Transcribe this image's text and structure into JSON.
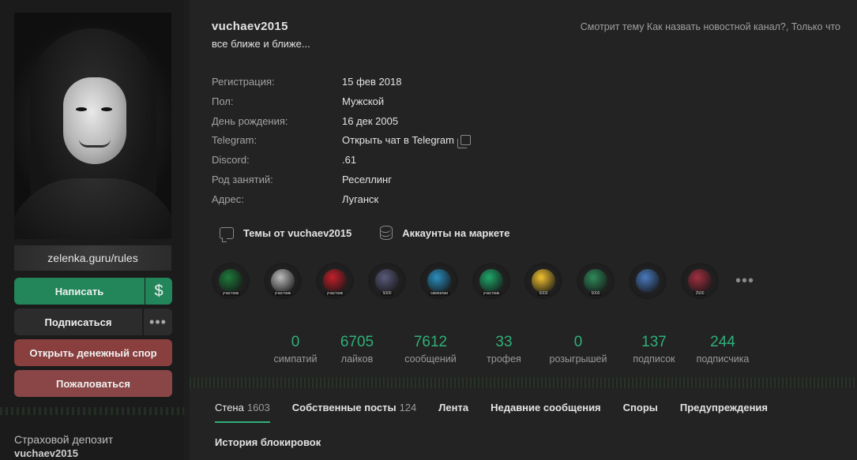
{
  "sidebar": {
    "status_banner": "zelenka.guru/rules",
    "write_label": "Написать",
    "dollar_label": "$",
    "subscribe_label": "Подписаться",
    "more_label": "•••",
    "dispute_label": "Открыть денежный спор",
    "report_label": "Пожаловаться",
    "deposit_label": "Страховой депозит",
    "deposit_name": "vuchaev2015"
  },
  "profile": {
    "username": "vuchaev2015",
    "status": "все ближе и ближе...",
    "activity": "Смотрит тему Как назвать новостной канал?, Только что",
    "info": [
      {
        "key": "Регистрация:",
        "value": "15 фев 2018"
      },
      {
        "key": "Пол:",
        "value": "Мужской"
      },
      {
        "key": "День рождения:",
        "value": "16 дек 2005"
      },
      {
        "key": "Telegram:",
        "value": "Открыть чат в Telegram"
      },
      {
        "key": "Discord:",
        "value": ".61"
      },
      {
        "key": "Род занятий:",
        "value": "Реселлинг"
      },
      {
        "key": "Адрес:",
        "value": "Луганск"
      }
    ],
    "links": {
      "topics": "Темы от vuchaev2015",
      "market": "Аккаунты на маркете"
    }
  },
  "trophies": [
    {
      "icon": "rainbow-six-badge-icon",
      "caption": "участник",
      "color": "#1f7a3a"
    },
    {
      "icon": "roblox-badge-icon",
      "caption": "участник",
      "color": "#bdbdbd"
    },
    {
      "icon": "valorant-badge-icon",
      "caption": "участник",
      "color": "#c1202b"
    },
    {
      "icon": "messages-5000-badge-icon",
      "caption": "5000",
      "color": "#5a5a7a"
    },
    {
      "icon": "sympathy-badge-icon",
      "caption": "симпатии",
      "color": "#2a8fbf"
    },
    {
      "icon": "ghost-badge-icon",
      "caption": "участник",
      "color": "#1fa86b"
    },
    {
      "icon": "heart-5000-badge-icon",
      "caption": "5000",
      "color": "#f2c230"
    },
    {
      "icon": "likes-5000-badge-icon",
      "caption": "5000",
      "color": "#2f8a5a"
    },
    {
      "icon": "bot-badge-icon",
      "caption": "",
      "color": "#4a7abf"
    },
    {
      "icon": "messages-2500-badge-icon",
      "caption": "2500",
      "color": "#a03040"
    }
  ],
  "trophies_more": "•••",
  "counters": [
    {
      "num": "0",
      "label": "симпатий"
    },
    {
      "num": "6705",
      "label": "лайков"
    },
    {
      "num": "7612",
      "label": "сообщений"
    },
    {
      "num": "33",
      "label": "трофея"
    },
    {
      "num": "0",
      "label": "розыгрышей"
    },
    {
      "num": "137",
      "label": "подписок"
    },
    {
      "num": "244",
      "label": "подписчика"
    }
  ],
  "tabs": {
    "wall": {
      "label": "Стена",
      "count": "1603"
    },
    "own_posts": {
      "label": "Собственные посты",
      "count": "124"
    },
    "feed": {
      "label": "Лента"
    },
    "recent": {
      "label": "Недавние сообщения"
    },
    "disputes": {
      "label": "Споры"
    },
    "warnings": {
      "label": "Предупреждения"
    },
    "bans": {
      "label": "История блокировок"
    }
  }
}
